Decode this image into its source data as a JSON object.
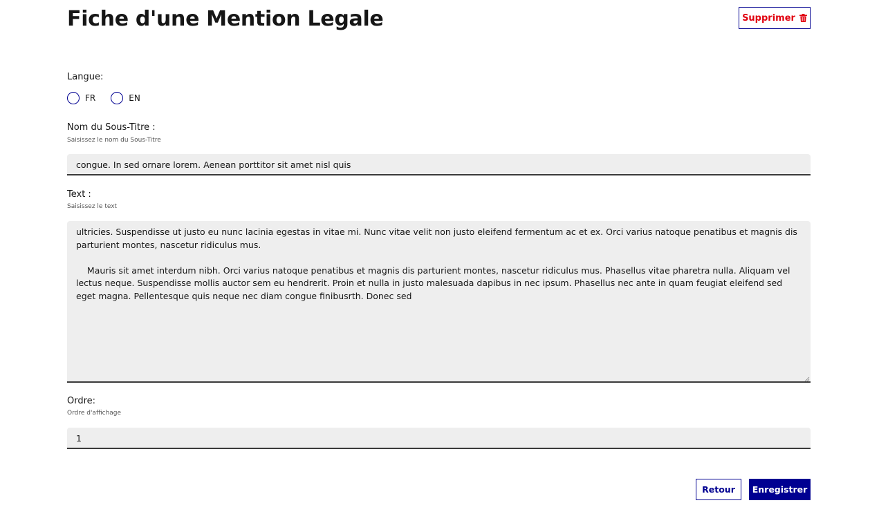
{
  "header": {
    "title": "Fiche d'une Mention Legale",
    "delete_label": "Supprimer"
  },
  "langue": {
    "label": "Langue:",
    "options": [
      "FR",
      "EN"
    ],
    "selected": null
  },
  "subtitle": {
    "label": "Nom du Sous-Titre :",
    "hint": "Saisissez le nom du Sous-Titre",
    "value": "congue. In sed ornare lorem. Aenean porttitor sit amet nisl quis"
  },
  "text": {
    "label": "Text :",
    "hint": "Saisissez le text",
    "value": "ultricies. Suspendisse ut justo eu nunc lacinia egestas in vitae mi. Nunc vitae velit non justo eleifend fermentum ac et ex. Orci varius natoque penatibus et magnis dis parturient montes, nascetur ridiculus mus.\n\n    Mauris sit amet interdum nibh. Orci varius natoque penatibus et magnis dis parturient montes, nascetur ridiculus mus. Phasellus vitae pharetra nulla. Aliquam vel lectus neque. Suspendisse mollis auctor sem eu hendrerit. Proin et nulla in justo malesuada dapibus in nec ipsum. Phasellus nec ante in quam feugiat eleifend sed eget magna. Pellentesque quis neque nec diam congue finibusrth. Donec sed"
  },
  "ordre": {
    "label": "Ordre:",
    "hint": "Ordre d'affichage",
    "value": "1"
  },
  "actions": {
    "back_label": "Retour",
    "save_label": "Enregistrer"
  },
  "colors": {
    "primary": "#000091",
    "danger": "#e1000f",
    "field_bg": "#eeeeee"
  }
}
